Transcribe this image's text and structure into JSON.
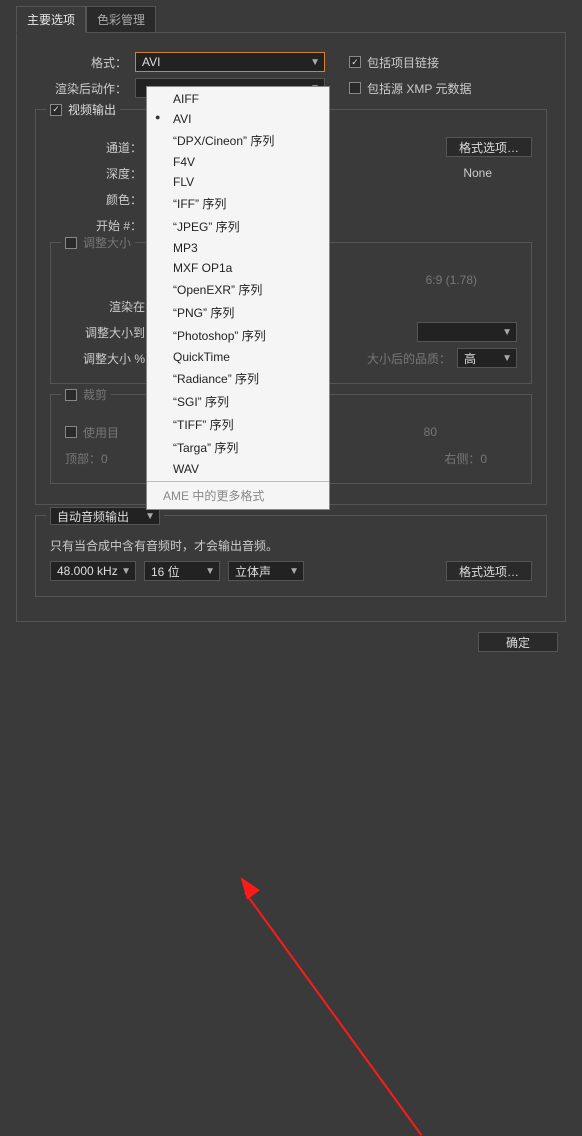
{
  "tabs": {
    "main": "主要选项",
    "color": "色彩管理"
  },
  "top": {
    "format_label": "格式：",
    "format_value": "AVI",
    "post_render_label": "渲染后动作：",
    "include_link": "包括项目链接",
    "include_xmp": "包括源 XMP 元数据"
  },
  "video": {
    "group_title": "视频输出",
    "channel_label": "通道：",
    "depth_label": "深度：",
    "color_label": "颜色：",
    "start_label": "开始 #：",
    "format_options_btn": "格式选项…",
    "none": "None",
    "ratio": "6:9 (1.78)",
    "resize_group": "调整大小",
    "render_at": "渲染在：",
    "resize_to": "调整大小到：",
    "resize_pct": "调整大小 %：",
    "resize_quality_label": "大小后的品质：",
    "resize_quality_value": "高",
    "crop_group": "裁剪",
    "use_target": "使用目",
    "crop_value": "80",
    "top_label": "顶部：0",
    "right_label": "右侧：0"
  },
  "audio": {
    "group_title": "自动音频输出",
    "desc": "只有当合成中含有音频时，才会输出音频。",
    "rate": "48.000 kHz",
    "bits": "16 位",
    "channels": "立体声",
    "format_options_btn": "格式选项…"
  },
  "footer": {
    "ok": "确定"
  },
  "dropdown": {
    "items": [
      "AIFF",
      "AVI",
      "“DPX/Cineon” 序列",
      "F4V",
      "FLV",
      "“IFF” 序列",
      "“JPEG” 序列",
      "MP3",
      "MXF OP1a",
      "“OpenEXR” 序列",
      "“PNG” 序列",
      "“Photoshop” 序列",
      "QuickTime",
      "“Radiance” 序列",
      "“SGI” 序列",
      "“TIFF” 序列",
      "“Targa” 序列",
      "WAV"
    ],
    "selected_index": 1,
    "footer": "AME 中的更多格式"
  }
}
